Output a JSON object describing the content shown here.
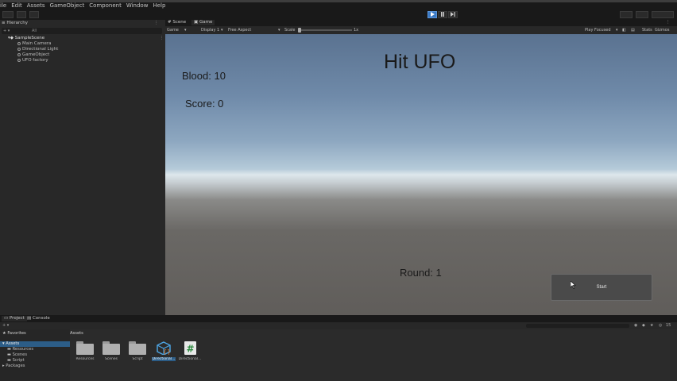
{
  "menubar": {
    "items": [
      "ile",
      "Edit",
      "Assets",
      "GameObject",
      "Component",
      "Window",
      "Help"
    ]
  },
  "toolbar": {
    "play_icon": "play-icon",
    "pause_icon": "pause-icon",
    "step_icon": "step-icon"
  },
  "hierarchy": {
    "tab_label": "Hierarchy",
    "search_placeholder": "All",
    "scene_name": "SampleScene",
    "items": [
      "Main Camera",
      "Directional Light",
      "GameObject",
      "UFO factory"
    ]
  },
  "game_tabs": {
    "scene_label": "Scene",
    "game_label": "Game"
  },
  "game_toolbar": {
    "mode": "Game",
    "display": "Display 1",
    "aspect": "Free Aspect",
    "scale_label": "Scale",
    "scale_value": "1x",
    "play_mode": "Play Focused",
    "stats": "Stats",
    "gizmos": "Gizmos"
  },
  "game_ui": {
    "title": "Hit UFO",
    "blood": "Blood: 10",
    "score": "Score: 0",
    "round": "Round: 1",
    "start_button": "Start"
  },
  "project": {
    "project_tab": "Project",
    "console_tab": "Console",
    "favorites": "Favorites",
    "assets_root": "Assets",
    "tree": [
      "Resources",
      "Scenes",
      "Script"
    ],
    "packages": "Packages",
    "breadcrumb": "Assets",
    "assets": [
      {
        "label": "Resources",
        "icon": "folder-icon"
      },
      {
        "label": "Scenes",
        "icon": "folder-icon"
      },
      {
        "label": "Script",
        "icon": "folder-icon"
      },
      {
        "label": "Directional...",
        "icon": "prefab-icon"
      },
      {
        "label": "Directional...",
        "icon": "csharp-script-icon"
      }
    ],
    "hidden_count": "15"
  },
  "colors": {
    "editor_bg": "#191919",
    "panel_bg": "#282828",
    "play_active": "#3a79c4",
    "sky_top": "#5a7290",
    "ground": "#605d5a"
  }
}
